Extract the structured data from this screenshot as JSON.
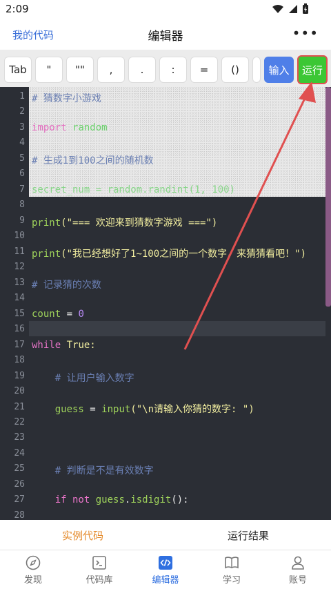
{
  "status": {
    "time": "2:09"
  },
  "header": {
    "left_link": "我的代码",
    "title": "编辑器",
    "more": "⋮"
  },
  "toolbar": {
    "keys": [
      "Tab",
      "\"",
      "\"\"",
      ",",
      ".",
      ":",
      "=",
      "()"
    ],
    "input_label": "输入",
    "run_label": "运行"
  },
  "editor": {
    "line_numbers": [
      "1",
      "2",
      "3",
      "4",
      "5",
      "6",
      "7",
      "8",
      "9",
      "10",
      "11",
      "12",
      "13",
      "14",
      "15",
      "16",
      "17",
      "18",
      "19",
      "20",
      "21",
      "22",
      "23",
      "24",
      "25",
      "26",
      "27",
      "28"
    ],
    "lines": {
      "l1": "# 猜数字小游戏",
      "l3_kw": "import",
      "l3_mod": "random",
      "l5": "# 生成1到100之间的随机数",
      "l7": "secret_num = random.randint(1, 100)",
      "l9_fn": "print",
      "l9_str": "(\"=== 欢迎来到猜数字游戏 ===\")",
      "l11_fn": "print",
      "l11_str": "(\"我已经想好了1~100之间的一个数字，来猜猜看吧！\")",
      "l13": "# 记录猜的次数",
      "l15_var": "count",
      "l15_op": " = ",
      "l15_num": "0",
      "l17_kw": "while",
      "l17_rest": " True:",
      "l19": "    # 让用户输入数字",
      "l21_var": "    guess",
      "l21_op": " = ",
      "l21_fn": "input",
      "l21_str": "(\"\\n请输入你猜的数字: \")",
      "l25": "    # 判断是不是有效数字",
      "l27_kw1": "    if",
      "l27_kw2": " not",
      "l27_var": " guess",
      "l27_op": ".",
      "l27_fn": "isdigit",
      "l27_end": "():"
    }
  },
  "subtabs": {
    "example": "实例代码",
    "results": "运行结果"
  },
  "nav": [
    {
      "label": "发现",
      "icon": "compass-icon"
    },
    {
      "label": "代码库",
      "icon": "terminal-icon"
    },
    {
      "label": "编辑器",
      "icon": "code-icon"
    },
    {
      "label": "学习",
      "icon": "book-icon"
    },
    {
      "label": "账号",
      "icon": "user-icon"
    }
  ],
  "colors": {
    "accent_blue": "#3a6fd8",
    "run_green": "#3cc734",
    "input_blue": "#4f7fe8",
    "arrow_red": "#e05050",
    "tab_orange": "#e48a2a"
  }
}
